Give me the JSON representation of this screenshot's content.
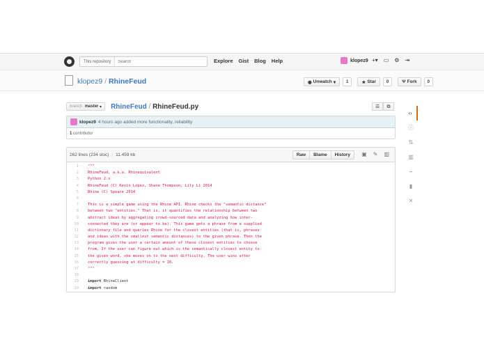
{
  "header": {
    "search_scope": "This repository",
    "search_placeholder": "Search",
    "nav": [
      "Explore",
      "Gist",
      "Blog",
      "Help"
    ],
    "username": "klopez9",
    "icons": [
      "plus-icon",
      "inbox-icon",
      "gear-icon",
      "signout-icon"
    ]
  },
  "repo": {
    "owner": "klopez9",
    "separator": "/",
    "name": "RhineFeud",
    "unwatch_label": "Unwatch",
    "unwatch_count": "1",
    "star_label": "Star",
    "star_count": "0",
    "fork_label": "Fork",
    "fork_count": "0"
  },
  "breadcrumb": {
    "branch_prefix": "branch:",
    "branch": "master",
    "root": "RhineFeud",
    "separator": "/",
    "file": "RhineFeud.py"
  },
  "commit": {
    "author": "klopez9",
    "message": "4 hours ago added more functionality, reliability",
    "contributors_count": "1",
    "contributors_label": "contributor"
  },
  "file": {
    "lines_info": "262 lines (234 sloc)",
    "size": "11.459 kb",
    "buttons": [
      "Raw",
      "Blame",
      "History"
    ],
    "code": [
      {
        "n": "1",
        "t": "\"\"\"",
        "k": "doc"
      },
      {
        "n": "2",
        "t": "RhineFeud, a.k.a. Rhinequivalent",
        "k": "doc"
      },
      {
        "n": "3",
        "t": "Python 2.x",
        "k": "doc"
      },
      {
        "n": "4",
        "t": "RhineFeud (C) Kevin Lopez, Shane Thompson, Lily Li 2014",
        "k": "doc"
      },
      {
        "n": "5",
        "t": "Rhine (C) Speare 2014",
        "k": "doc"
      },
      {
        "n": "6",
        "t": "",
        "k": "doc"
      },
      {
        "n": "7",
        "t": "This is a simple game using the Rhine API. Rhine checks the \"semantic distance\"",
        "k": "doc"
      },
      {
        "n": "8",
        "t": "between two \"entities.\" That is, it quantifies the relationship between two",
        "k": "doc"
      },
      {
        "n": "9",
        "t": "abstract ideas by aggregating crowd-sourced data and analyzing how inter-",
        "k": "doc"
      },
      {
        "n": "10",
        "t": "connected they are (or appear to be). This game gets a phrase from a supplied",
        "k": "doc"
      },
      {
        "n": "11",
        "t": "dictionary file and queries Rhine for the closest entities (that is, phrases",
        "k": "doc"
      },
      {
        "n": "12",
        "t": "and ideas with the smallest semantic distances) to the given phrase. Then the",
        "k": "doc"
      },
      {
        "n": "13",
        "t": "program gives the user a certain amount of these closest entities to choose",
        "k": "doc"
      },
      {
        "n": "14",
        "t": "from. If the user can figure out which is the semantically closest entity to",
        "k": "doc"
      },
      {
        "n": "15",
        "t": "the given word, she moves on to the next difficulty. The user wins after",
        "k": "doc"
      },
      {
        "n": "16",
        "t": "correctly guessing at difficulty = 10.",
        "k": "doc"
      },
      {
        "n": "17",
        "t": "\"\"\"",
        "k": "doc"
      },
      {
        "n": "18",
        "t": "",
        "k": "plain"
      },
      {
        "n": "19",
        "t": "import RhineClient",
        "k": "import"
      },
      {
        "n": "20",
        "t": "import random",
        "k": "import"
      }
    ]
  },
  "sidebar_icons": [
    "code-icon",
    "issues-icon",
    "pull-requests-icon",
    "wiki-icon",
    "pulse-icon",
    "graphs-icon",
    "settings-icon"
  ]
}
